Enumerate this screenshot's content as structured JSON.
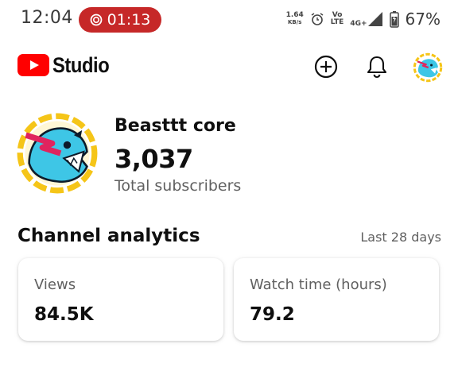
{
  "status_bar": {
    "time": "12:04",
    "recording_timer": "01:13",
    "net_speed_value": "1.64",
    "net_speed_unit": "KB/s",
    "volte_top": "Vo",
    "volte_bottom": "LTE",
    "network_type": "4G+",
    "battery_percent": "67%"
  },
  "header": {
    "app_name": "Studio",
    "brand_color": "#ff0000",
    "icons": [
      "youtube-logo",
      "add-circle-icon",
      "bell-icon",
      "avatar"
    ]
  },
  "channel": {
    "name": "Beasttt core",
    "subscriber_count": "3,037",
    "subscriber_label": "Total subscribers"
  },
  "analytics": {
    "title": "Channel analytics",
    "range": "Last 28 days",
    "cards": [
      {
        "label": "Views",
        "value": "84.5K"
      },
      {
        "label": "Watch time (hours)",
        "value": "79.2"
      }
    ]
  }
}
